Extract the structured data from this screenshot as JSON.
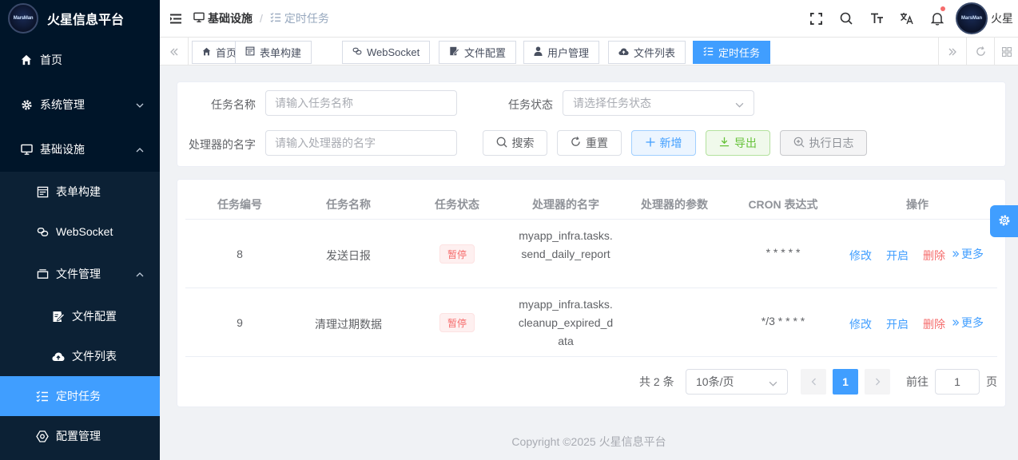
{
  "app": {
    "title": "火星信息平台",
    "logo_text": "MarsMan"
  },
  "sidebar": {
    "items": [
      {
        "label": "首页",
        "icon": "home-icon"
      },
      {
        "label": "系统管理",
        "icon": "gear-icon"
      },
      {
        "label": "基础设施",
        "icon": "monitor-icon"
      },
      {
        "label": "表单构建",
        "icon": "form-icon"
      },
      {
        "label": "WebSocket",
        "icon": "link-icon"
      },
      {
        "label": "文件管理",
        "icon": "folder-icon"
      },
      {
        "label": "文件配置",
        "icon": "edit-file-icon"
      },
      {
        "label": "文件列表",
        "icon": "cloud-upload-icon"
      },
      {
        "label": "定时任务",
        "icon": "task-list-icon"
      },
      {
        "label": "配置管理",
        "icon": "config-icon"
      }
    ]
  },
  "header": {
    "breadcrumb": [
      "基础设施",
      "定时任务"
    ],
    "username": "火星"
  },
  "tags": [
    {
      "label": "首页"
    },
    {
      "label": "表单构建"
    },
    {
      "label": "WebSocket"
    },
    {
      "label": "文件配置"
    },
    {
      "label": "用户管理"
    },
    {
      "label": "文件列表"
    },
    {
      "label": "定时任务",
      "active": true
    }
  ],
  "search": {
    "task_name_label": "任务名称",
    "task_name_placeholder": "请输入任务名称",
    "task_status_label": "任务状态",
    "task_status_placeholder": "请选择任务状态",
    "handler_label": "处理器的名字",
    "handler_placeholder": "请输入处理器的名字",
    "search_btn": "搜索",
    "reset_btn": "重置",
    "add_btn": "新增",
    "export_btn": "导出",
    "log_btn": "执行日志"
  },
  "table": {
    "columns": [
      "任务编号",
      "任务名称",
      "任务状态",
      "处理器的名字",
      "处理器的参数",
      "CRON 表达式",
      "操作"
    ],
    "rows": [
      {
        "id": "8",
        "name": "发送日报",
        "status": "暂停",
        "handler": "myapp_infra.tasks.send_daily_report",
        "param": "",
        "cron": "* * * * *"
      },
      {
        "id": "9",
        "name": "清理过期数据",
        "status": "暂停",
        "handler": "myapp_infra.tasks.cleanup_expired_data",
        "param": "",
        "cron": "*/3 * * * *"
      }
    ],
    "actions": {
      "edit": "修改",
      "start": "开启",
      "delete": "删除",
      "more": "更多"
    }
  },
  "pagination": {
    "total_text": "共 2 条",
    "page_size": "10条/页",
    "current_page": "1",
    "goto_label": "前往",
    "goto_value": "1",
    "page_suffix": "页"
  },
  "footer": {
    "copyright": "Copyright ©2025 火星信息平台"
  },
  "colors": {
    "sidebar_bg": "#001529",
    "accent": "#409eff",
    "danger": "#f56c6c",
    "success": "#67c23a"
  }
}
